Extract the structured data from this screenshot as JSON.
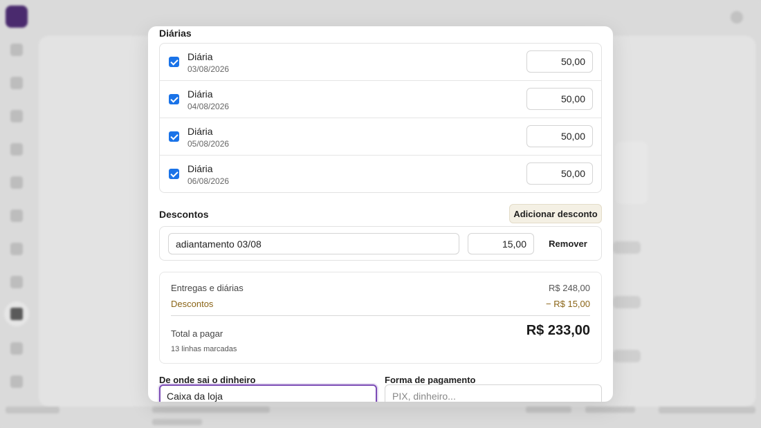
{
  "diarias": {
    "title": "Diárias",
    "items": [
      {
        "label": "Diária",
        "date": "03/08/2026",
        "value": "50,00",
        "checked": true
      },
      {
        "label": "Diária",
        "date": "04/08/2026",
        "value": "50,00",
        "checked": true
      },
      {
        "label": "Diária",
        "date": "05/08/2026",
        "value": "50,00",
        "checked": true
      },
      {
        "label": "Diária",
        "date": "06/08/2026",
        "value": "50,00",
        "checked": true
      }
    ]
  },
  "descontos": {
    "title": "Descontos",
    "add_button": "Adicionar desconto",
    "items": [
      {
        "description": "adiantamento 03/08",
        "value": "15,00",
        "remove_label": "Remover"
      }
    ]
  },
  "summary": {
    "entregas_label": "Entregas e diárias",
    "entregas_value": "R$ 248,00",
    "descontos_label": "Descontos",
    "descontos_value": "− R$ 15,00",
    "total_label": "Total a pagar",
    "total_value": "R$ 233,00",
    "lines_note": "13 linhas marcadas"
  },
  "payment": {
    "source_label": "De onde sai o dinheiro",
    "source_value": "Caixa da loja",
    "method_label": "Forma de pagamento",
    "method_placeholder": "PIX, dinheiro..."
  },
  "colors": {
    "accent": "#7b4bb5",
    "checkbox": "#1a73e8",
    "discount": "#8a6416"
  }
}
